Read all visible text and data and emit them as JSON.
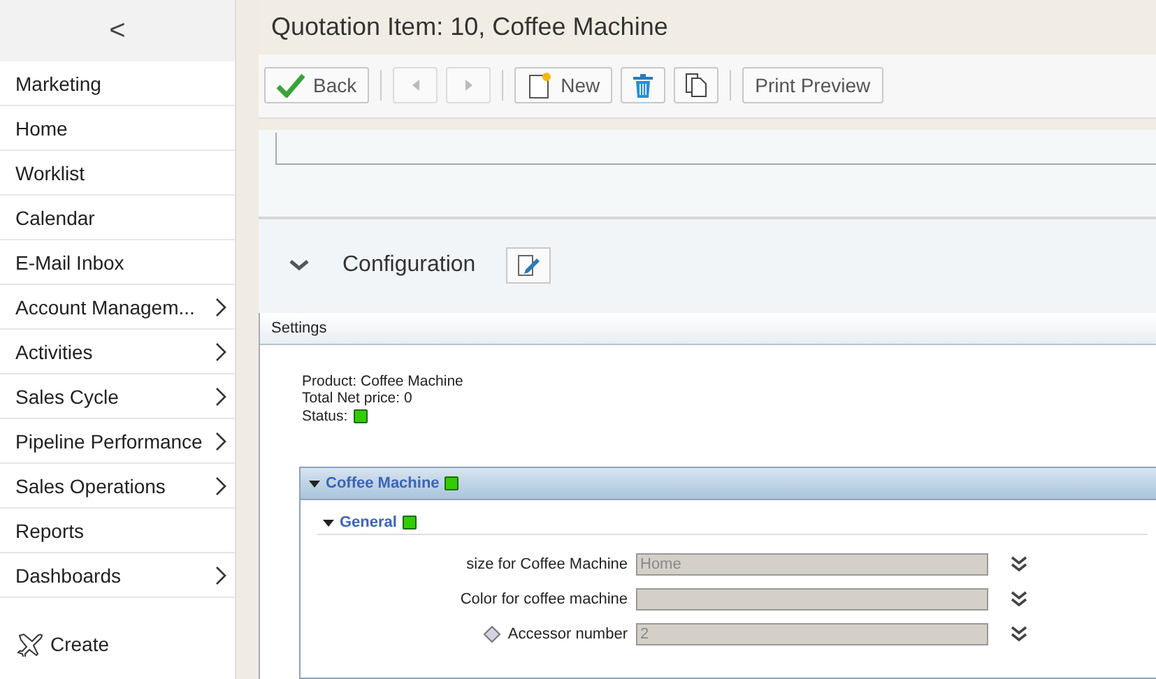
{
  "sidebar": {
    "collapse_icon": "<",
    "items": [
      {
        "label": "Marketing",
        "has_submenu": false
      },
      {
        "label": "Home",
        "has_submenu": false
      },
      {
        "label": "Worklist",
        "has_submenu": false
      },
      {
        "label": "Calendar",
        "has_submenu": false
      },
      {
        "label": "E-Mail Inbox",
        "has_submenu": false
      },
      {
        "label": "Account Managem...",
        "has_submenu": true
      },
      {
        "label": "Activities",
        "has_submenu": true
      },
      {
        "label": "Sales Cycle",
        "has_submenu": true
      },
      {
        "label": "Pipeline Performance",
        "has_submenu": true
      },
      {
        "label": "Sales Operations",
        "has_submenu": true
      },
      {
        "label": "Reports",
        "has_submenu": false
      },
      {
        "label": "Dashboards",
        "has_submenu": true
      }
    ],
    "create_label": "Create"
  },
  "page_title": "Quotation Item: 10, Coffee Machine",
  "toolbar": [
    {
      "kind": "back",
      "label": "Back",
      "disabled": false
    },
    {
      "kind": "separator"
    },
    {
      "kind": "prev",
      "disabled": true
    },
    {
      "kind": "next",
      "disabled": true
    },
    {
      "kind": "separator"
    },
    {
      "kind": "new",
      "label": "New",
      "disabled": false
    },
    {
      "kind": "delete",
      "disabled": false
    },
    {
      "kind": "copy",
      "disabled": false
    },
    {
      "kind": "separator"
    },
    {
      "kind": "text",
      "label": "Print Preview",
      "disabled": false
    }
  ],
  "configuration": {
    "title": "Configuration",
    "expanded": true,
    "settings_tab": "Settings",
    "info": [
      "Product: Coffee Machine",
      "Total Net price: 0"
    ],
    "status_label": "Status:",
    "status_ok": true,
    "group": {
      "title": "Coffee Machine",
      "expanded": true,
      "status_ok": true,
      "subgroup": {
        "title": "General",
        "expanded": true,
        "status_ok": true,
        "fields": [
          {
            "label": "size for Coffee Machine",
            "value": "Home",
            "flagged": false,
            "disabled": true
          },
          {
            "label": "Color for coffee machine",
            "flagged": false,
            "disabled": true
          },
          {
            "label": "Accessor number",
            "value": "2",
            "flagged": true,
            "disabled": true
          }
        ]
      }
    }
  }
}
